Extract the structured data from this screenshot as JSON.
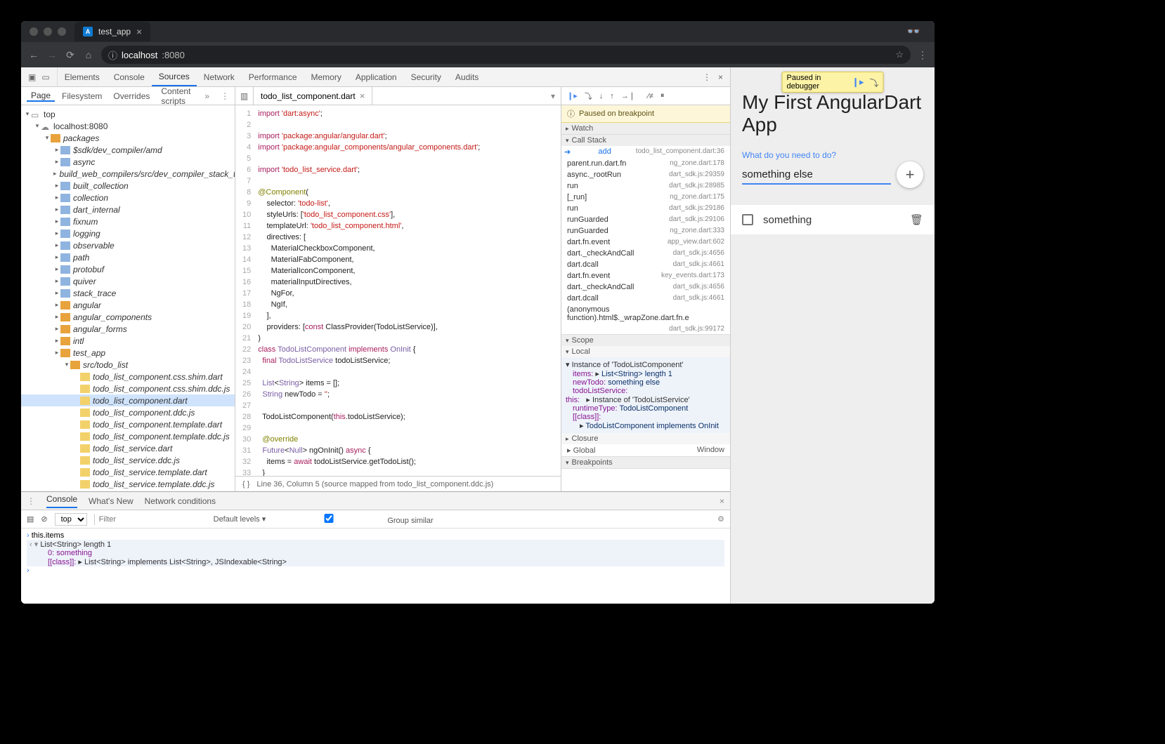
{
  "browser": {
    "tab_title": "test_app",
    "url_prefix": "localhost",
    "url_suffix": ":8080"
  },
  "devtools": {
    "tabs": [
      "Elements",
      "Console",
      "Sources",
      "Network",
      "Performance",
      "Memory",
      "Application",
      "Security",
      "Audits"
    ],
    "active_tab": "Sources",
    "subtabs": [
      "Page",
      "Filesystem",
      "Overrides",
      "Content scripts"
    ],
    "active_subtab": "Page"
  },
  "file_tree": {
    "top": "top",
    "host": "localhost:8080",
    "packages": "packages",
    "pkg_list": [
      "$sdk/dev_compiler/amd",
      "async",
      "build_web_compilers/src/dev_compiler_stack_trace",
      "built_collection",
      "collection",
      "dart_internal",
      "fixnum",
      "logging",
      "observable",
      "path",
      "protobuf",
      "quiver",
      "stack_trace"
    ],
    "pkg_open": [
      "angular",
      "angular_components",
      "angular_forms",
      "intl",
      "test_app"
    ],
    "src_folder": "src/todo_list",
    "files": [
      "todo_list_component.css.shim.dart",
      "todo_list_component.css.shim.ddc.js",
      "todo_list_component.dart",
      "todo_list_component.ddc.js",
      "todo_list_component.template.dart",
      "todo_list_component.template.ddc.js",
      "todo_list_service.dart",
      "todo_list_service.ddc.js",
      "todo_list_service.template.dart",
      "todo_list_service.template.ddc.js"
    ],
    "selected_file": "todo_list_component.dart"
  },
  "editor": {
    "open_file": "todo_list_component.dart",
    "status": "Line 36, Column 5   (source mapped from todo_list_component.ddc.js)"
  },
  "debugger": {
    "paused_msg": "Paused on breakpoint",
    "sections": {
      "watch": "Watch",
      "callstack": "Call Stack",
      "scope": "Scope",
      "local": "Local",
      "closure": "Closure",
      "global": "Global",
      "global_val": "Window",
      "breakpoints": "Breakpoints"
    },
    "stack": [
      {
        "fn": "add",
        "loc": "todo_list_component.dart:36",
        "cur": true
      },
      {
        "fn": "parent.run.dart.fn",
        "loc": "ng_zone.dart:178"
      },
      {
        "fn": "async._rootRun",
        "loc": "dart_sdk.js:29359"
      },
      {
        "fn": "run",
        "loc": "dart_sdk.js:28985"
      },
      {
        "fn": "[_run]",
        "loc": "ng_zone.dart:175"
      },
      {
        "fn": "run",
        "loc": "dart_sdk.js:29186"
      },
      {
        "fn": "runGuarded",
        "loc": "dart_sdk.js:29106"
      },
      {
        "fn": "runGuarded",
        "loc": "ng_zone.dart:333"
      },
      {
        "fn": "dart.fn.event",
        "loc": "app_view.dart:602"
      },
      {
        "fn": "dart._checkAndCall",
        "loc": "dart_sdk.js:4656"
      },
      {
        "fn": "dart.dcall",
        "loc": "dart_sdk.js:4661"
      },
      {
        "fn": "dart.fn.event",
        "loc": "key_events.dart:173"
      },
      {
        "fn": "dart._checkAndCall",
        "loc": "dart_sdk.js:4656"
      },
      {
        "fn": "dart.dcall",
        "loc": "dart_sdk.js:4661"
      },
      {
        "fn": "(anonymous function).html$._wrapZone.dart.fn.e",
        "loc": ""
      },
      {
        "fn": "",
        "loc": "dart_sdk.js:99172"
      }
    ],
    "local": {
      "instance": "Instance of 'TodoListComponent'",
      "items": "List<String> length 1",
      "newTodo": "something else",
      "todoListService_inst": "Instance of 'TodoListService'",
      "runtimeType": "TodoListComponent",
      "class_impl": "TodoListComponent implements OnInit",
      "this_lbl": "this:",
      "items_lbl": "items:",
      "newTodo_lbl": "newTodo:",
      "tls_lbl": "todoListService:",
      "rt_lbl": "runtimeType:",
      "cls_lbl": "[[class]]:"
    }
  },
  "console": {
    "tabs": [
      "Console",
      "What's New",
      "Network conditions"
    ],
    "context": "top",
    "filter_ph": "Filter",
    "levels": "Default levels",
    "group": "Group similar",
    "input": "this.items",
    "out_head": "List<String> length 1",
    "out_0": "0: something",
    "out_class": "[[class]]: ",
    "out_impl": "List<String> implements List<String>, JSIndexable<String>"
  },
  "app": {
    "overlay": "Paused in debugger",
    "title": "My First AngularDart App",
    "label": "What do you need to do?",
    "input_value": "something else",
    "todo": "something"
  }
}
